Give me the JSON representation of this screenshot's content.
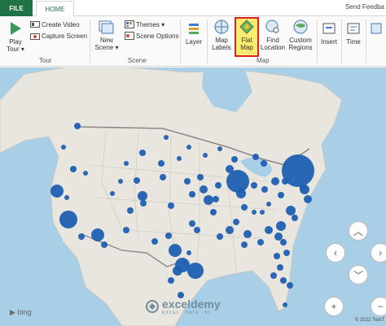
{
  "tabs": {
    "file": "FILE",
    "home": "HOME"
  },
  "feedback": "Send Feedba",
  "tour": {
    "play_tour_1": "Play",
    "play_tour_2": "Tour",
    "create_video": "Create Video",
    "capture_screen": "Capture Screen",
    "label": "Tour"
  },
  "scene": {
    "new_scene_1": "New",
    "new_scene_2": "Scene",
    "themes": "Themes",
    "scene_options": "Scene Options",
    "label": "Scene"
  },
  "layer": {
    "label": "Layer"
  },
  "map_group": {
    "map_labels_1": "Map",
    "map_labels_2": "Labels",
    "flat_map_1": "Flat",
    "flat_map_2": "Map",
    "find_location_1": "Find",
    "find_location_2": "Location",
    "custom_regions_1": "Custom",
    "custom_regions_2": "Regions",
    "label": "Map"
  },
  "insert": {
    "label": "Insert"
  },
  "time": {
    "label": "Time"
  },
  "map_view": {
    "bing": "bing",
    "watermark": "exceldemy",
    "watermark_sub": "EXCEL · DATA · BI",
    "copyright": "© 2022 TomT"
  },
  "colors": {
    "accent": "#217346",
    "bubble": "#1f5fb0",
    "water": "#a9cfe7",
    "land": "#e9e6e0"
  }
}
